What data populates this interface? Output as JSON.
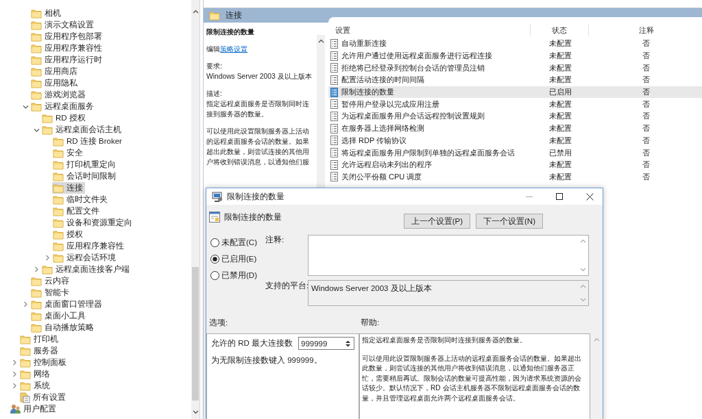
{
  "tree": {
    "items": [
      {
        "children": [
          {
            "children": [
              {
                "label": "相机",
                "kind": "folder",
                "selected": false
              },
              {
                "label": "演示文稿设置",
                "kind": "folder",
                "selected": false
              },
              {
                "label": "应用程序包部署",
                "kind": "folder",
                "selected": false
              },
              {
                "label": "应用程序兼容性",
                "kind": "folder",
                "selected": false
              },
              {
                "label": "应用程序运行时",
                "kind": "folder",
                "selected": false
              },
              {
                "label": "应用商店",
                "kind": "folder",
                "selected": false
              },
              {
                "label": "应用隐私",
                "kind": "folder",
                "selected": false
              },
              {
                "label": "游戏浏览器",
                "kind": "folder",
                "selected": false
              },
              {
                "label": "远程桌面服务",
                "kind": "folder",
                "expanded": true,
                "selected": false,
                "children": [
                  {
                    "label": "RD 授权",
                    "kind": "folder",
                    "selected": false
                  },
                  {
                    "label": "远程桌面会话主机",
                    "kind": "folder",
                    "expanded": true,
                    "selected": false,
                    "children": [
                      {
                        "label": "RD 连接 Broker",
                        "kind": "folder",
                        "selected": false
                      },
                      {
                        "label": "安全",
                        "kind": "folder",
                        "selected": false
                      },
                      {
                        "label": "打印机重定向",
                        "kind": "folder",
                        "selected": false
                      },
                      {
                        "label": "会话时间限制",
                        "kind": "folder",
                        "selected": false
                      },
                      {
                        "label": "连接",
                        "kind": "folder",
                        "selected": true
                      },
                      {
                        "label": "临时文件夹",
                        "kind": "folder",
                        "selected": false
                      },
                      {
                        "label": "配置文件",
                        "kind": "folder",
                        "selected": false
                      },
                      {
                        "label": "设备和资源重定向",
                        "kind": "folder",
                        "selected": false
                      },
                      {
                        "label": "授权",
                        "kind": "folder",
                        "selected": false
                      },
                      {
                        "label": "应用程序兼容性",
                        "kind": "folder",
                        "selected": false
                      },
                      {
                        "label": "远程会话环境",
                        "kind": "folder",
                        "expanded": false,
                        "selected": false
                      }
                    ]
                  },
                  {
                    "label": "远程桌面连接客户端",
                    "kind": "folder",
                    "expanded": false,
                    "selected": false
                  }
                ]
              },
              {
                "label": "云内容",
                "kind": "folder",
                "selected": false
              },
              {
                "label": "智能卡",
                "kind": "folder",
                "selected": false
              },
              {
                "label": "桌面窗口管理器",
                "kind": "folder",
                "expanded": false,
                "selected": false
              },
              {
                "label": "桌面小工具",
                "kind": "folder",
                "selected": false
              },
              {
                "label": "自动播放策略",
                "kind": "folder",
                "selected": false
              }
            ]
          },
          {
            "label": "打印机",
            "kind": "folder",
            "selected": false
          },
          {
            "label": "服务器",
            "kind": "folder",
            "selected": false
          },
          {
            "label": "控制面板",
            "kind": "folder",
            "expanded": false,
            "selected": false
          },
          {
            "label": "网络",
            "kind": "folder",
            "expanded": false,
            "selected": false
          },
          {
            "label": "系统",
            "kind": "folder",
            "expanded": false,
            "selected": false
          },
          {
            "label": "所有设置",
            "kind": "settings",
            "selected": false
          }
        ]
      },
      {
        "label": "用户配置",
        "kind": "user",
        "selected": false
      }
    ]
  },
  "details_header": {
    "title": "连接"
  },
  "description": {
    "title": "限制连接的数量",
    "edit_prefix": "编辑",
    "edit_link": "策略设置",
    "requirements_label": "要求:",
    "requirements": "Windows Server 2003 及以上版本",
    "description_label": "描述:",
    "paragraphs": [
      "指定远程桌面服务是否限制同时连接到服务器的数量。",
      "可以使用此设置限制服务器上活动的远程桌面服务会话的数量。如果超出此数量，则尝试连接的其他用户将收到错误消息，以通知他们服"
    ]
  },
  "settings_table": {
    "columns": [
      "设置",
      "状态",
      "注释"
    ],
    "rows": [
      {
        "name": "自动重新连接",
        "status": "未配置",
        "comment": "否",
        "selected": false
      },
      {
        "name": "允许用户通过使用远程桌面服务进行远程连接",
        "status": "未配置",
        "comment": "否",
        "selected": false
      },
      {
        "name": "拒绝将已经登录到控制台会话的管理员注销",
        "status": "未配置",
        "comment": "否",
        "selected": false
      },
      {
        "name": "配置活动连接的时间间隔",
        "status": "未配置",
        "comment": "否",
        "selected": false
      },
      {
        "name": "限制连接的数量",
        "status": "已启用",
        "comment": "否",
        "selected": true
      },
      {
        "name": "暂停用户登录以完成应用注册",
        "status": "未配置",
        "comment": "否",
        "selected": false
      },
      {
        "name": "为远程桌面服务用户会话远程控制设置规则",
        "status": "未配置",
        "comment": "否",
        "selected": false
      },
      {
        "name": "在服务器上选择网络检测",
        "status": "未配置",
        "comment": "否",
        "selected": false
      },
      {
        "name": "选择 RDP 传输协议",
        "status": "未配置",
        "comment": "否",
        "selected": false
      },
      {
        "name": "将远程桌面服务用户限制到单独的远程桌面服务会话",
        "status": "已禁用",
        "comment": "否",
        "selected": false
      },
      {
        "name": "允许远程启动未列出的程序",
        "status": "未配置",
        "comment": "否",
        "selected": false
      },
      {
        "name": "关闭公平份额 CPU 调度",
        "status": "未配置",
        "comment": "否",
        "selected": false
      }
    ]
  },
  "dialog": {
    "title": "限制连接的数量",
    "heading": "限制连接的数量",
    "nav_buttons": [
      "上一个设置(P)",
      "下一个设置(N)"
    ],
    "options": [
      {
        "label": "未配置(C)",
        "selected": false
      },
      {
        "label": "已启用(E)",
        "selected": true
      },
      {
        "label": "已禁用(D)",
        "selected": false
      }
    ],
    "comment_label": "注释:",
    "platform_label": "支持的平台:",
    "platform": "Windows Server 2003 及以上版本",
    "options_label": "选项:",
    "help_label": "帮助:",
    "max_connections_label": "允许的 RD 最大连接数",
    "max_connections": "999999",
    "max_connections_hint": "为无限制连接数键入 999999。",
    "help": [
      "指定远程桌面服务是否限制同时连接到服务器的数量。",
      "可以使用此设置限制服务器上活动的远程桌面服务会话的数量。如果超出此数量，则尝试连接的其他用户将收到错误消息，以通知他们服务器正忙，需要稍后再试。限制会话的数量可提高性能，因为请求系统资源的会话较少。默认情况下，RD 会话主机服务器不限制远程桌面服务会话的数量，并且管理远程桌面允许两个远程桌面服务会话。"
    ]
  }
}
